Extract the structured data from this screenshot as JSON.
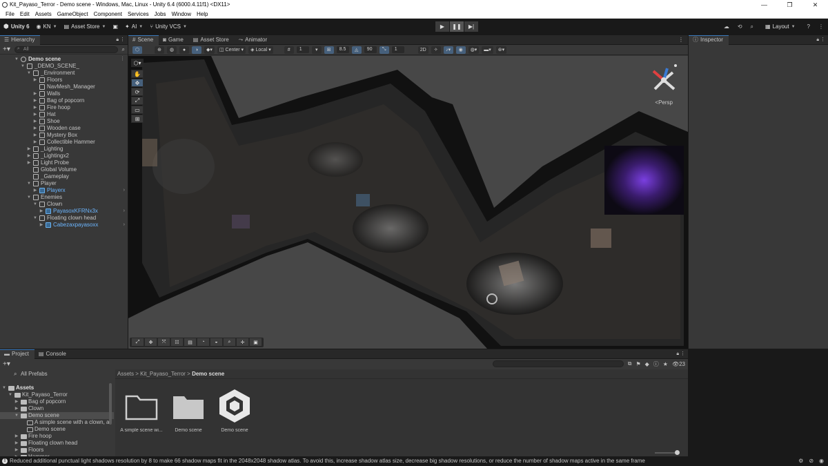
{
  "window": {
    "title": "Kit_Payaso_Terror - Demo scene - Windows, Mac, Linux - Unity 6.4 (6000.4.11f1) <DX11>",
    "controls": [
      "—",
      "❐",
      "✕"
    ]
  },
  "menu": [
    "File",
    "Edit",
    "Assets",
    "GameObject",
    "Component",
    "Services",
    "Jobs",
    "Window",
    "Help"
  ],
  "toolbar": {
    "unity_label": "Unity 6",
    "account": "KN",
    "asset_store": "Asset Store",
    "ai": "AI",
    "vcs": "Unity VCS",
    "play_icons": [
      "▶",
      "❚❚",
      "▶|"
    ],
    "layout": "Layout"
  },
  "hierarchy": {
    "tab": "Hierarchy",
    "search_placeholder": "All",
    "rows": [
      {
        "label": "Demo scene",
        "depth": 0,
        "arrow": "▼",
        "icon": "scene",
        "bold": true
      },
      {
        "label": "_DEMO_SCENE_",
        "depth": 1,
        "arrow": "▼",
        "icon": "cube"
      },
      {
        "label": "_Environment",
        "depth": 2,
        "arrow": "▼",
        "icon": "cube"
      },
      {
        "label": "Floors",
        "depth": 3,
        "arrow": "▶",
        "icon": "cube"
      },
      {
        "label": "NavMesh_Manager",
        "depth": 3,
        "arrow": "",
        "icon": "cube"
      },
      {
        "label": "Walls",
        "depth": 3,
        "arrow": "▶",
        "icon": "cube"
      },
      {
        "label": "Bag of popcorn",
        "depth": 3,
        "arrow": "▶",
        "icon": "cube"
      },
      {
        "label": "Fire hoop",
        "depth": 3,
        "arrow": "▶",
        "icon": "cube"
      },
      {
        "label": "Hat",
        "depth": 3,
        "arrow": "▶",
        "icon": "cube"
      },
      {
        "label": "Shoe",
        "depth": 3,
        "arrow": "▶",
        "icon": "cube"
      },
      {
        "label": "Wooden case",
        "depth": 3,
        "arrow": "▶",
        "icon": "cube"
      },
      {
        "label": "Mystery Box",
        "depth": 3,
        "arrow": "▶",
        "icon": "cube"
      },
      {
        "label": "Collectible Hammer",
        "depth": 3,
        "arrow": "▶",
        "icon": "cube"
      },
      {
        "label": "_Lighting",
        "depth": 2,
        "arrow": "▶",
        "icon": "cube"
      },
      {
        "label": "_Lightingx2",
        "depth": 2,
        "arrow": "▶",
        "icon": "cube"
      },
      {
        "label": "Light Probe",
        "depth": 2,
        "arrow": "▶",
        "icon": "cube"
      },
      {
        "label": "Global Volume",
        "depth": 2,
        "arrow": "",
        "icon": "cube"
      },
      {
        "label": "_Gameplay",
        "depth": 2,
        "arrow": "",
        "icon": "cube"
      },
      {
        "label": "Player",
        "depth": 2,
        "arrow": "▼",
        "icon": "cube"
      },
      {
        "label": "Playerx",
        "depth": 3,
        "arrow": "▶",
        "icon": "prefab",
        "blue": true,
        "more": true
      },
      {
        "label": "Enemies",
        "depth": 2,
        "arrow": "▼",
        "icon": "cube"
      },
      {
        "label": "Clown",
        "depth": 3,
        "arrow": "▼",
        "icon": "cube"
      },
      {
        "label": "PayasoxKFRNx3x",
        "depth": 4,
        "arrow": "▶",
        "icon": "prefab",
        "blue": true,
        "more": true
      },
      {
        "label": "Floating clown head",
        "depth": 3,
        "arrow": "▼",
        "icon": "cube"
      },
      {
        "label": "Cabezaxpayasoxx",
        "depth": 4,
        "arrow": "▶",
        "icon": "prefab",
        "blue": true,
        "more": true
      }
    ]
  },
  "scene": {
    "tabs": [
      "Scene",
      "Game",
      "Asset Store",
      "Animator"
    ],
    "pivot": "Center",
    "space": "Local",
    "grid_value": "1",
    "snap_value": "8.5",
    "rotate_value": "90",
    "scale_value": "1",
    "persp_label": "Persp",
    "view_tools": [
      "✋",
      "✥",
      "⟳",
      "⤢",
      "▭",
      "⊞"
    ]
  },
  "inspector": {
    "tab": "Inspector"
  },
  "project": {
    "tabs": [
      "Project",
      "Console"
    ],
    "search_all_prefabs": "All Prefabs",
    "count": "23",
    "breadcrumb": [
      "Assets",
      "Kit_Payaso_Terror",
      "Demo scene"
    ],
    "tree": [
      {
        "label": "Assets",
        "depth": 0,
        "arrow": "▼",
        "type": "folder",
        "bold": true
      },
      {
        "label": "Kit_Payaso_Terror",
        "depth": 1,
        "arrow": "▼",
        "type": "folder"
      },
      {
        "label": "Bag of popcorn",
        "depth": 2,
        "arrow": "▶",
        "type": "folder"
      },
      {
        "label": "Clown",
        "depth": 2,
        "arrow": "▶",
        "type": "folder"
      },
      {
        "label": "Demo scene",
        "depth": 2,
        "arrow": "▼",
        "type": "folder",
        "selected": true
      },
      {
        "label": "A simple scene with a clown, a",
        "depth": 3,
        "arrow": "",
        "type": "folder"
      },
      {
        "label": "Demo scene",
        "depth": 3,
        "arrow": "",
        "type": "folder"
      },
      {
        "label": "Fire hoop",
        "depth": 2,
        "arrow": "▶",
        "type": "folder"
      },
      {
        "label": "Floating clown head",
        "depth": 2,
        "arrow": "▶",
        "type": "folder"
      },
      {
        "label": "Floors",
        "depth": 2,
        "arrow": "▶",
        "type": "folder"
      },
      {
        "label": "Hammer",
        "depth": 2,
        "arrow": "▶",
        "type": "folder"
      }
    ],
    "assets": [
      {
        "caption": "A simple scene wi...",
        "kind": "folder-empty"
      },
      {
        "caption": "Demo scene",
        "kind": "folder"
      },
      {
        "caption": "Demo scene",
        "kind": "unity-scene"
      }
    ]
  },
  "status": {
    "message": "Reduced additional punctual light shadows resolution by 8 to make 66 shadow maps fit in the 2048x2048 shadow atlas. To avoid this, increase shadow atlas size, decrease big shadow resolutions, or reduce the number of shadow maps active in the same frame"
  }
}
